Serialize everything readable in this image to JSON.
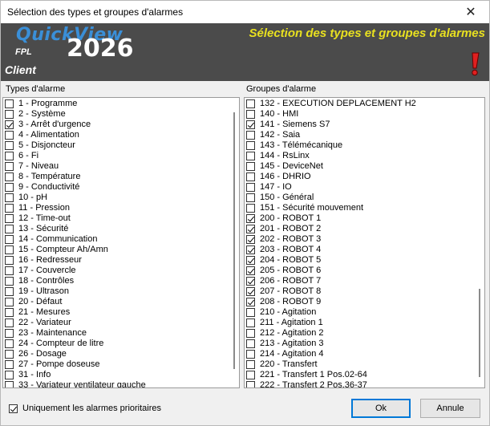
{
  "window": {
    "title": "Sélection des types et groupes d'alarmes"
  },
  "banner": {
    "brand": "QuickView",
    "sub": "FPL",
    "client": "Client",
    "year": "2026",
    "heading": "Sélection des types et groupes d'alarmes"
  },
  "types_label": "Types d'alarme",
  "groups_label": "Groupes d'alarme",
  "types": [
    {
      "label": "1 - Programme",
      "checked": false
    },
    {
      "label": "2 - Système",
      "checked": false
    },
    {
      "label": "3 - Arrêt d'urgence",
      "checked": true
    },
    {
      "label": "4 - Alimentation",
      "checked": false
    },
    {
      "label": "5 - Disjoncteur",
      "checked": false
    },
    {
      "label": "6 - Fi",
      "checked": false
    },
    {
      "label": "7 - Niveau",
      "checked": false
    },
    {
      "label": "8 - Température",
      "checked": false
    },
    {
      "label": "9 - Conductivité",
      "checked": false
    },
    {
      "label": "10 - pH",
      "checked": false
    },
    {
      "label": "11 - Pression",
      "checked": false
    },
    {
      "label": "12 - Time-out",
      "checked": false
    },
    {
      "label": "13 - Sécurité",
      "checked": false
    },
    {
      "label": "14 - Communication",
      "checked": false
    },
    {
      "label": "15 - Compteur Ah/Amn",
      "checked": false
    },
    {
      "label": "16 - Redresseur",
      "checked": false
    },
    {
      "label": "17 - Couvercle",
      "checked": false
    },
    {
      "label": "18 - Contrôles",
      "checked": false
    },
    {
      "label": "19 - Ultrason",
      "checked": false
    },
    {
      "label": "20 - Défaut",
      "checked": false
    },
    {
      "label": "21 - Mesures",
      "checked": false
    },
    {
      "label": "22 - Variateur",
      "checked": false
    },
    {
      "label": "23 - Maintenance",
      "checked": false
    },
    {
      "label": "24 - Compteur de litre",
      "checked": false
    },
    {
      "label": "26 - Dosage",
      "checked": false
    },
    {
      "label": "27 - Pompe doseuse",
      "checked": false
    },
    {
      "label": "31 - Info",
      "checked": false
    },
    {
      "label": "33 - Variateur ventilateur gauche",
      "checked": false
    }
  ],
  "groups": [
    {
      "label": "132 - EXECUTION DEPLACEMENT H2",
      "checked": false
    },
    {
      "label": "140 - HMI",
      "checked": false
    },
    {
      "label": "141 - Siemens S7",
      "checked": true
    },
    {
      "label": "142 - Saia",
      "checked": false
    },
    {
      "label": "143 - Télémécanique",
      "checked": false
    },
    {
      "label": "144 - RsLinx",
      "checked": false
    },
    {
      "label": "145 - DeviceNet",
      "checked": false
    },
    {
      "label": "146 - DHRIO",
      "checked": false
    },
    {
      "label": "147 - IO",
      "checked": false
    },
    {
      "label": "150 - Général",
      "checked": false
    },
    {
      "label": "151 - Sécurité mouvement",
      "checked": false
    },
    {
      "label": "200 - ROBOT 1",
      "checked": true
    },
    {
      "label": "201 - ROBOT 2",
      "checked": true
    },
    {
      "label": "202 - ROBOT 3",
      "checked": true
    },
    {
      "label": "203 - ROBOT 4",
      "checked": true
    },
    {
      "label": "204 - ROBOT 5",
      "checked": true
    },
    {
      "label": "205 - ROBOT 6",
      "checked": true
    },
    {
      "label": "206 - ROBOT 7",
      "checked": true
    },
    {
      "label": "207 - ROBOT 8",
      "checked": true
    },
    {
      "label": "208 - ROBOT 9",
      "checked": true
    },
    {
      "label": "210 - Agitation",
      "checked": false
    },
    {
      "label": "211 - Agitation 1",
      "checked": false
    },
    {
      "label": "212 - Agitation 2",
      "checked": false
    },
    {
      "label": "213 - Agitation 3",
      "checked": false
    },
    {
      "label": "214 - Agitation 4",
      "checked": false
    },
    {
      "label": "220 - Transfert",
      "checked": false
    },
    {
      "label": "221 - Transfert 1 Pos.02-64",
      "checked": false
    },
    {
      "label": "222 - Transfert 2 Pos.36-37",
      "checked": false
    }
  ],
  "priority_only": {
    "label": "Uniquement les alarmes prioritaires",
    "checked": true
  },
  "buttons": {
    "ok": "Ok",
    "cancel": "Annule"
  },
  "icons": {
    "close": "close-icon",
    "alert": "exclamation-icon"
  },
  "colors": {
    "banner_bg": "#4b4b4b",
    "brand": "#3a8fd8",
    "heading": "#e8e020",
    "alert": "#e02020"
  }
}
